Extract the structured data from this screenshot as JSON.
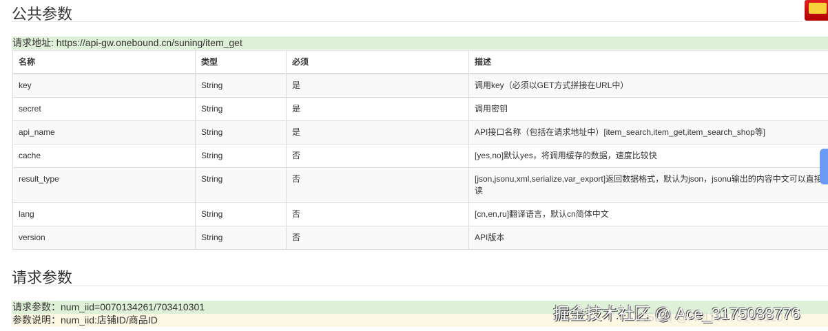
{
  "public_params": {
    "title": "公共参数",
    "request_url_label": "请求地址: https://api-gw.onebound.cn/suning/item_get",
    "headers": [
      "名称",
      "类型",
      "必须",
      "描述"
    ],
    "rows": [
      [
        "key",
        "String",
        "是",
        "调用key（必须以GET方式拼接在URL中）"
      ],
      [
        "secret",
        "String",
        "是",
        "调用密钥"
      ],
      [
        "api_name",
        "String",
        "是",
        "API接口名称（包括在请求地址中）[item_search,item_get,item_search_shop等]"
      ],
      [
        "cache",
        "String",
        "否",
        "[yes,no]默认yes，将调用缓存的数据，速度比较快"
      ],
      [
        "result_type",
        "String",
        "否",
        "[json,jsonu,xml,serialize,var_export]返回数据格式，默认为json，jsonu输出的内容中文可以直接阅读"
      ],
      [
        "lang",
        "String",
        "否",
        "[cn,en,ru]翻译语言，默认cn简体中文"
      ],
      [
        "version",
        "String",
        "否",
        "API版本"
      ]
    ]
  },
  "request_params": {
    "title": "请求参数",
    "params_line": "请求参数：num_iid=0070134261/703410301",
    "desc_line": "参数说明：num_iid:店铺ID/商品ID"
  },
  "watermarks": [
    "掘金技术社区 @ Ace_3175088776",
    "CSDN @API19970108110"
  ]
}
